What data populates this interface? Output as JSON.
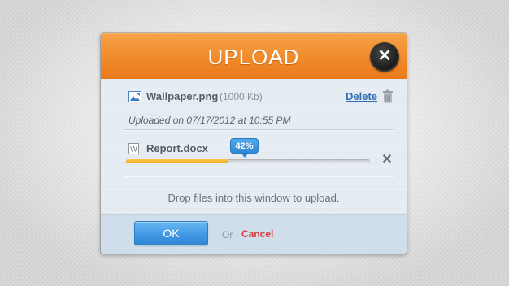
{
  "dialog": {
    "title": "UPLOAD"
  },
  "files": [
    {
      "name": "Wallpaper.png",
      "size": "(1000 Kb)",
      "icon": "image-file-icon",
      "action_label": "Delete",
      "status_text": "Uploaded on 07/17/2012 at 10:55 PM"
    },
    {
      "name": "Report.docx",
      "icon": "word-document-icon",
      "progress_label": "42%",
      "progress": 0.42
    }
  ],
  "drop_hint": "Drop files into this window to upload.",
  "footer": {
    "ok_label": "OK",
    "or_label": "Or",
    "cancel_label": "Cancel"
  },
  "icons": {
    "close": "close-icon",
    "trash": "trash-icon",
    "remove": "remove-x-icon"
  },
  "colors": {
    "header_orange": "#f08a2a",
    "progress_yellow": "#f2b230",
    "accent_blue": "#3f96e2",
    "cancel_red": "#e23a3a",
    "link_blue": "#2f6fb5"
  }
}
